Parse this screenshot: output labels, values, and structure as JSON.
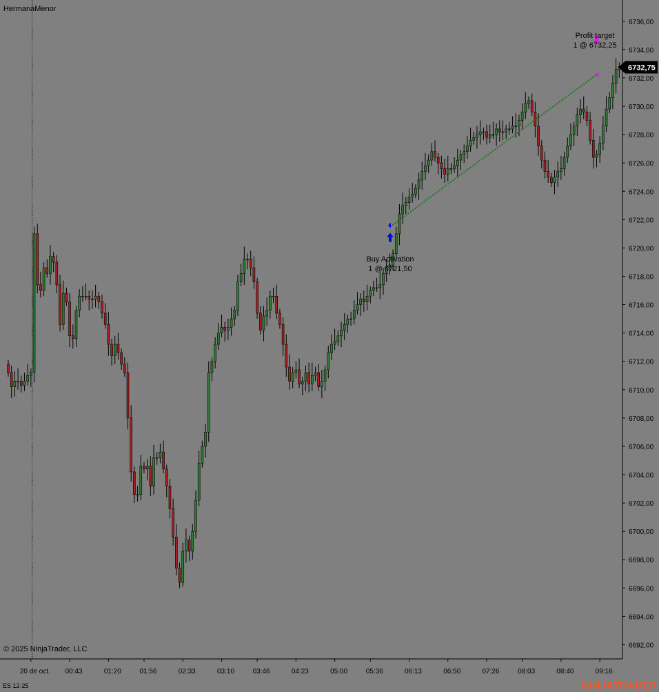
{
  "window": {
    "title": "HermanaMenor",
    "instrument": "ES 12-25",
    "copyright": "© 2025 NinjaTrader, LLC",
    "brand": "NINJATRADER"
  },
  "colors": {
    "background": "#808080",
    "up_candle": "#2e7d32",
    "down_candle": "#a52020",
    "wick": "#000000",
    "trade_line": "#1b7a1b",
    "buy_marker": "#0000ff",
    "sell_marker": "#ff00ff",
    "price_tag_bg": "#000000",
    "price_tag_text": "#ffffff",
    "brand": "#ff5522"
  },
  "annotations": {
    "buy_label": "Buy Activation",
    "buy_detail": "1 @ 6721,50",
    "target_label": "Profit target",
    "target_detail": "1 @ 6732,25",
    "last_price": "6732,75"
  },
  "chart_data": {
    "type": "candlestick",
    "y_axis": {
      "min": 6691,
      "max": 6737.5,
      "tick_labels": [
        "6736,00",
        "6734,00",
        "6732,00",
        "6730,00",
        "6728,00",
        "6726,00",
        "6724,00",
        "6722,00",
        "6720,00",
        "6718,00",
        "6716,00",
        "6714,00",
        "6712,00",
        "6710,00",
        "6708,00",
        "6706,00",
        "6704,00",
        "6702,00",
        "6700,00",
        "6698,00",
        "6696,00",
        "6694,00",
        "6692,00"
      ],
      "tick_values": [
        6736,
        6734,
        6732,
        6730,
        6728,
        6726,
        6724,
        6722,
        6720,
        6718,
        6716,
        6714,
        6712,
        6710,
        6708,
        6706,
        6704,
        6702,
        6700,
        6698,
        6696,
        6694,
        6692
      ]
    },
    "x_axis": {
      "tick_labels": [
        "20 de oct.",
        "00:43",
        "01:20",
        "01:56",
        "02:33",
        "03:10",
        "03:46",
        "04:23",
        "05:00",
        "05:36",
        "06:13",
        "06:50",
        "07:26",
        "08:03",
        "08:40",
        "09:16"
      ],
      "tick_bar_index": [
        7,
        19,
        31,
        42,
        54,
        66,
        77,
        89,
        101,
        112,
        124,
        136,
        148,
        159,
        171,
        183
      ]
    },
    "session_break_bar_index": 7,
    "bar_count": 190,
    "closes": [
      6711.2,
      6710.2,
      6710.6,
      6710.6,
      6710.3,
      6710.6,
      6711.0,
      6711.2,
      6721.0,
      6717.4,
      6717.0,
      6718.6,
      6718.2,
      6719.4,
      6719.0,
      6717.4,
      6714.6,
      6716.8,
      6716.2,
      6713.8,
      6713.6,
      6715.6,
      6716.6,
      6716.6,
      6716.6,
      6716.4,
      6716.4,
      6716.6,
      6716.2,
      6715.4,
      6714.6,
      6713.2,
      6712.4,
      6713.2,
      6712.6,
      6711.8,
      6711.2,
      6708.0,
      6704.2,
      6702.6,
      6702.6,
      6704.6,
      6704.4,
      6704.6,
      6703.2,
      6705.2,
      6705.2,
      6705.6,
      6704.4,
      6703.2,
      6701.6,
      6699.6,
      6697.4,
      6696.4,
      6698.6,
      6699.4,
      6698.6,
      6700.0,
      6702.2,
      6704.8,
      6706.0,
      6707.0,
      6711.2,
      6712.0,
      6713.2,
      6714.0,
      6714.4,
      6714.2,
      6714.4,
      6715.0,
      6715.6,
      6717.6,
      6718.2,
      6719.2,
      6719.2,
      6718.6,
      6717.6,
      6715.4,
      6714.2,
      6715.2,
      6715.6,
      6716.6,
      6716.6,
      6715.4,
      6714.6,
      6713.2,
      6711.6,
      6710.6,
      6711.2,
      6711.4,
      6710.4,
      6710.6,
      6711.2,
      6710.4,
      6711.0,
      6711.2,
      6710.2,
      6710.6,
      6711.4,
      6712.6,
      6713.2,
      6713.4,
      6713.8,
      6714.2,
      6714.6,
      6715.0,
      6715.0,
      6715.6,
      6716.0,
      6716.4,
      6716.2,
      6716.6,
      6717.0,
      6717.2,
      6717.2,
      6717.4,
      6718.2,
      6718.6,
      6718.8,
      6719.6,
      6721.0,
      6722.4,
      6723.0,
      6723.2,
      6723.6,
      6723.8,
      6724.2,
      6724.8,
      6725.4,
      6725.8,
      6726.2,
      6726.8,
      6726.4,
      6726.0,
      6725.6,
      6725.2,
      6725.6,
      6725.6,
      6725.8,
      6726.2,
      6726.6,
      6726.8,
      6727.2,
      6727.6,
      6727.8,
      6728.0,
      6728.2,
      6728.2,
      6727.8,
      6728.0,
      6728.0,
      6728.4,
      6728.2,
      6728.2,
      6728.4,
      6728.4,
      6728.6,
      6728.6,
      6729.0,
      6729.6,
      6730.2,
      6730.4,
      6729.6,
      6728.6,
      6727.2,
      6726.2,
      6725.4,
      6725.0,
      6724.6,
      6725.0,
      6725.4,
      6725.6,
      6726.4,
      6727.2,
      6728.0,
      6728.6,
      6729.4,
      6729.8,
      6729.6,
      6729.0,
      6727.6,
      6726.4,
      6726.6,
      6727.4,
      6728.6,
      6729.8,
      6730.6,
      6731.6,
      6732.6,
      6732.8,
      6733.0,
      6732.75
    ]
  }
}
